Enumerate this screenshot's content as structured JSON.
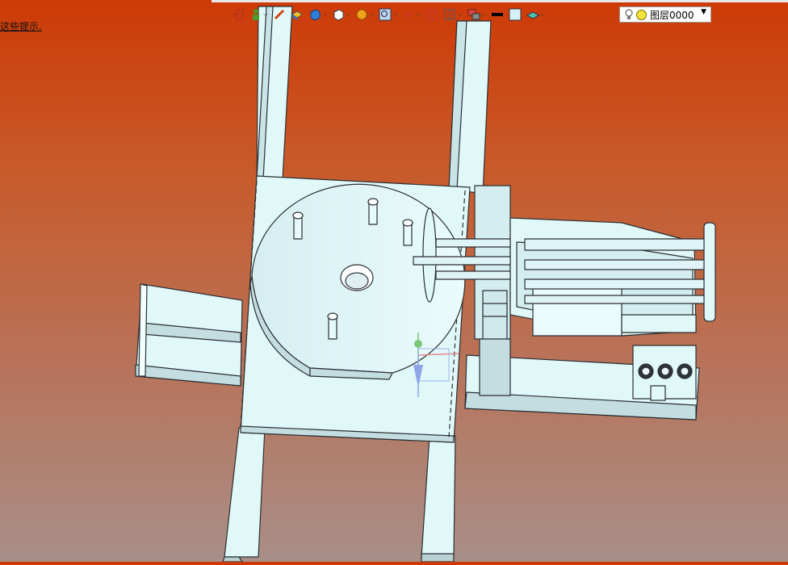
{
  "hint_text": "这些提示.",
  "toolbar": {
    "items": [
      {
        "icon": "exit-icon"
      },
      {
        "icon": "green-person-icon",
        "dropdown": true
      },
      {
        "icon": "pencil-icon"
      },
      {
        "icon": "yellow-box-icon"
      },
      {
        "icon": "blue-cube-icon",
        "dropdown": true
      },
      {
        "icon": "white-cube-icon",
        "dropdown": true
      },
      {
        "icon": "orange-sphere-icon",
        "dropdown": true
      },
      {
        "icon": "zoom-icon",
        "dropdown": true
      },
      {
        "icon": "axis-icon",
        "dropdown": true
      },
      {
        "icon": "section-icon"
      },
      {
        "icon": "frame-icon",
        "dropdown": true
      },
      {
        "icon": "stack-icon",
        "dropdown": true
      },
      {
        "icon": "black-line-icon"
      },
      {
        "icon": "color-swatch-icon"
      },
      {
        "icon": "layer-plane-icon",
        "dropdown": true
      }
    ],
    "layer": {
      "name": "图层0000"
    }
  },
  "colors": {
    "part_fill": "#e1f8f9",
    "part_edge": "#2b2f33",
    "bg_top": "#cd3a07",
    "bg_bottom": "#a88f88"
  }
}
